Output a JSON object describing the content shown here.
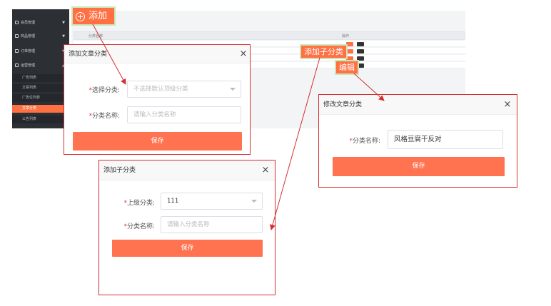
{
  "sidebar": {
    "items": [
      {
        "label": "会员管理",
        "icon": "user-icon"
      },
      {
        "label": "商品管理",
        "icon": "box-icon"
      },
      {
        "label": "订单管理",
        "icon": "order-icon"
      },
      {
        "label": "运营管理",
        "icon": "operation-icon"
      }
    ],
    "sub_items": [
      "广告列表",
      "文章列表",
      "广告位列表",
      "文章分类",
      "公告列表"
    ],
    "active_sub": "文章分类"
  },
  "table": {
    "col_name": "分类名称",
    "col_ops": "操作"
  },
  "callouts": {
    "add": "添加",
    "add_child": "添加子分类",
    "edit": "编辑"
  },
  "dialog_add": {
    "title": "添加文章分类",
    "close": "×",
    "select_label": "选择分类:",
    "select_placeholder": "不选择默认顶级分类",
    "name_label": "分类名称:",
    "name_placeholder": "请输入分类名称",
    "save": "保存"
  },
  "dialog_edit": {
    "title": "修改文章分类",
    "close": "×",
    "name_label": "分类名称:",
    "name_value": "风格豆腐干反对",
    "save": "保存"
  },
  "dialog_child": {
    "title": "添加子分类",
    "close": "×",
    "parent_label": "上级分类:",
    "parent_value": "111",
    "name_label": "分类名称:",
    "name_placeholder": "请输入分类名称",
    "save": "保存"
  },
  "colors": {
    "accent": "#ff7043",
    "annotation": "#d32f2f",
    "sidebar": "#2c2f34"
  }
}
